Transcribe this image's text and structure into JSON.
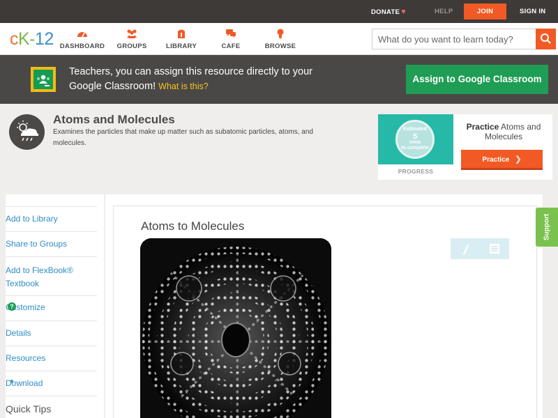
{
  "topbar": {
    "donate": "DONATE",
    "help": "HELP",
    "join": "JOIN",
    "sign_in": "SIGN IN"
  },
  "logo": {
    "c": "c",
    "k": "K-",
    "n": "12"
  },
  "nav": [
    {
      "label": "DASHBOARD",
      "icon": "dashboard-icon"
    },
    {
      "label": "GROUPS",
      "icon": "groups-icon"
    },
    {
      "label": "LIBRARY",
      "icon": "library-icon"
    },
    {
      "label": "CAFE",
      "icon": "cafe-icon"
    },
    {
      "label": "BROWSE",
      "icon": "browse-icon"
    }
  ],
  "search": {
    "placeholder": "What do you want to learn today?"
  },
  "banner": {
    "text": "Teachers, you can assign this resource directly to your Google Classroom!",
    "link": "What is this?",
    "button": "Assign to Google Classroom"
  },
  "concept": {
    "title": "Atoms and Molecules",
    "description": "Examines the particles that make up matter such as subatomic particles, atoms, and molecules."
  },
  "practice": {
    "badge_line1": "Estimated",
    "badge_number": "5",
    "badge_unit": "mins",
    "badge_line3": "to complete",
    "progress_label": "PROGRESS",
    "title_bold": "Practice",
    "title_rest": " Atoms and Molecules",
    "button": "Practice"
  },
  "sidebar": [
    {
      "label": "Add to Library"
    },
    {
      "label": "Share to Groups"
    },
    {
      "label": "Add to FlexBook® Textbook"
    },
    {
      "label": "Customize"
    },
    {
      "label": "Details"
    },
    {
      "label": "Resources"
    },
    {
      "label": "Download"
    },
    {
      "label": "Quick Tips"
    }
  ],
  "article": {
    "title": "Atoms to Molecules",
    "image_icon": "field-ion-microscope-image"
  },
  "support": "Support",
  "colors": {
    "accent": "#f15a24",
    "green": "#1f9d55",
    "link": "#2e8dc4",
    "topbar": "#3e3a38"
  }
}
